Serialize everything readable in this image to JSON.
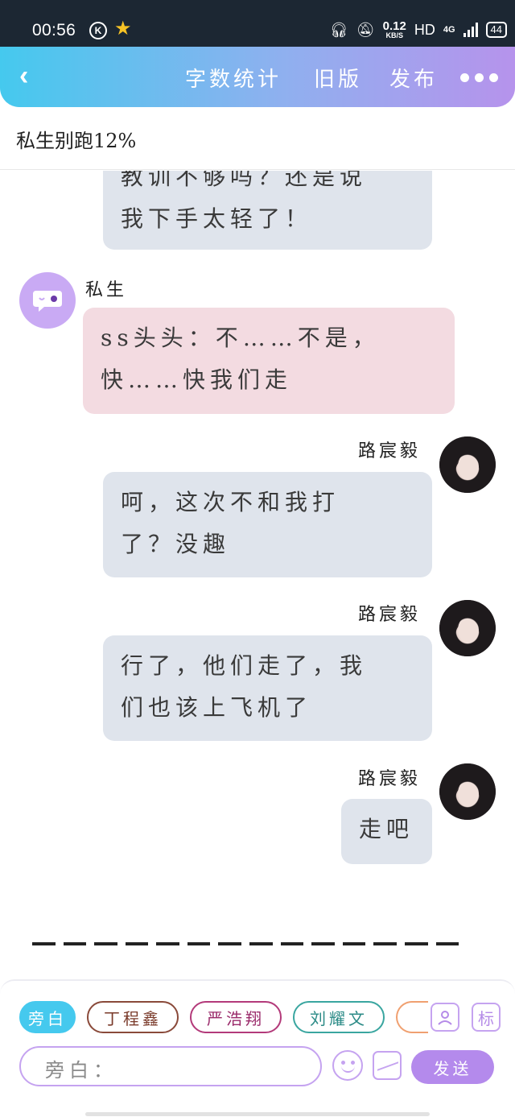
{
  "status_bar": {
    "time": "00:56",
    "k_badge": "K",
    "net_speed": "0.12",
    "net_unit": "KB/S",
    "hd": "HD",
    "network": "4G",
    "battery": "44"
  },
  "header": {
    "count_label": "字数统计",
    "old_label": "旧版",
    "publish_label": "发布"
  },
  "title": "私生别跑12%",
  "messages": [
    {
      "side": "right",
      "sender": "",
      "text_lines": [
        "教训不够吗？还是说",
        "我下手太轻了！"
      ]
    },
    {
      "side": "left",
      "sender": "私生",
      "text_lines": [
        "ss头头：不……不是，",
        "快……快我们走"
      ]
    },
    {
      "side": "right",
      "sender": "路宸毅",
      "text_lines": [
        "呵，这次不和我打",
        "了？没趣"
      ]
    },
    {
      "side": "right",
      "sender": "路宸毅",
      "text_lines": [
        "行了，他们走了，我",
        "们也该上飞机了"
      ]
    },
    {
      "side": "right",
      "sender": "路宸毅",
      "text_lines": [
        "走吧"
      ]
    }
  ],
  "roles": {
    "aside": "旁白",
    "r1": "丁程鑫",
    "r2": "严浩翔",
    "r3": "刘耀文"
  },
  "icons": {
    "role": "role-card-icon",
    "tag": "标",
    "emoji": "emoji-icon",
    "image": "image-icon"
  },
  "composer": {
    "placeholder": "旁白：",
    "send_label": "发送"
  },
  "colors": {
    "accent_start": "#45c9ee",
    "accent_end": "#b693ec",
    "bubble_blue": "#dfe4ec",
    "bubble_pink": "#f3dbe1",
    "send": "#b48aec"
  }
}
